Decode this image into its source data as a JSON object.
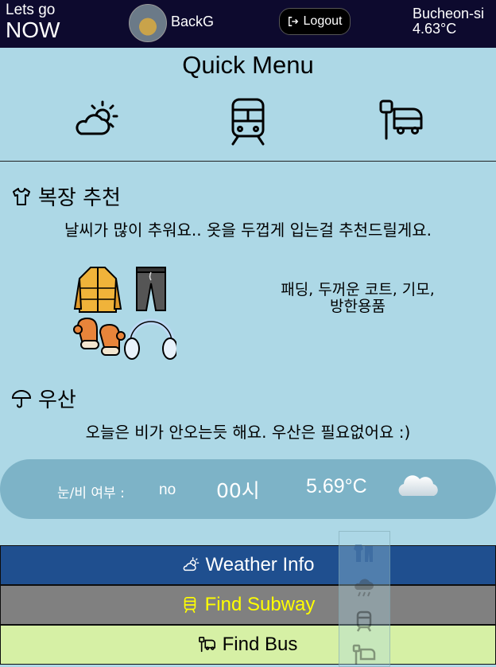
{
  "header": {
    "brand_line1": "Lets go",
    "brand_line2": "NOW",
    "username": "BackG",
    "logout_label": "Logout",
    "city": "Bucheon-si",
    "temperature": "4.63°C"
  },
  "quick_menu": {
    "title": "Quick Menu",
    "icons": [
      "weather-icon",
      "subway-icon",
      "bus-stop-icon"
    ]
  },
  "clothing": {
    "title": "복장 추천",
    "message": "날씨가 많이 추워요.. 옷을 두껍게 입는걸 추천드릴게요.",
    "items_line1": "패딩, 두꺼운 코트, 기모,",
    "items_line2": "방한용품"
  },
  "umbrella": {
    "title": "우산",
    "message": "오늘은 비가 안오는듯 해요. 우산은 필요없어요 :)"
  },
  "forecast": {
    "precip_label": "눈/비 여부 :",
    "precip_value": "no",
    "time": "00시",
    "temperature": "5.69°C",
    "icon": "cloud-icon"
  },
  "nav": {
    "weather_label": "Weather Info",
    "subway_label": "Find Subway",
    "bus_label": "Find Bus"
  },
  "colors": {
    "background": "#add8e6",
    "header_bg": "#0d0a2e",
    "weather_btn": "#1f4f8f",
    "subway_btn": "#808080",
    "subway_text": "#ffff00",
    "bus_btn": "#d6f0a5"
  }
}
